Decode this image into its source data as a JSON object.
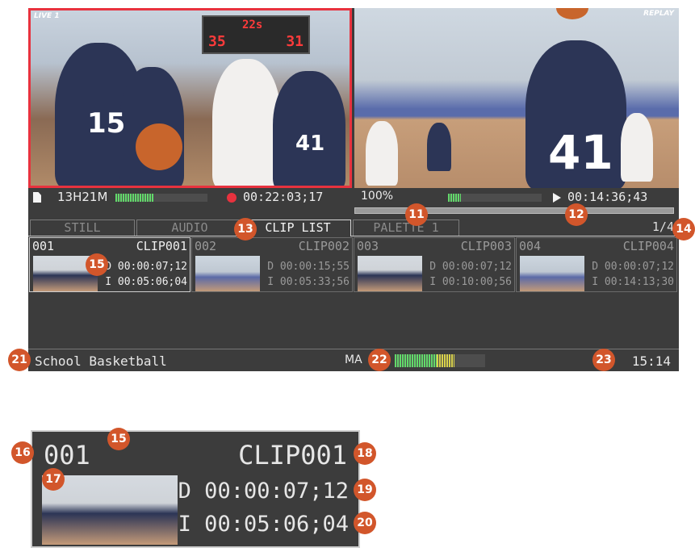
{
  "screen": {
    "live_label": "LIVE 1",
    "replay_label": "REPLAY",
    "scoreboard": {
      "clock": "22s",
      "home": "35",
      "away": "31"
    },
    "live_jerseys": [
      "15",
      "41"
    ],
    "replay_jerseys": [
      "41"
    ],
    "status_left": {
      "remaining": "13H21M",
      "rec_time": "00:22:03;17"
    },
    "status_right": {
      "zoom": "100%",
      "play_time": "00:14:36;43"
    },
    "tabs": [
      {
        "label": "STILL",
        "active": false
      },
      {
        "label": "AUDIO",
        "active": false
      },
      {
        "label": "CLIP LIST",
        "active": true
      },
      {
        "label": "PALETTE 1",
        "active": false
      }
    ],
    "pager": "1/4",
    "clips": [
      {
        "num": "001",
        "name": "CLIP001",
        "duration": "D 00:00:07;12",
        "in": "I 00:05:06;04",
        "selected": true
      },
      {
        "num": "002",
        "name": "CLIP002",
        "duration": "D 00:00:15;55",
        "in": "I 00:05:33;56",
        "selected": false
      },
      {
        "num": "003",
        "name": "CLIP003",
        "duration": "D 00:00:07;12",
        "in": "I 00:10:00;56",
        "selected": false
      },
      {
        "num": "004",
        "name": "CLIP004",
        "duration": "D 00:00:07;12",
        "in": "I 00:14:13;30",
        "selected": false
      }
    ],
    "bottom": {
      "project": "School Basketball",
      "audio_label": "MA",
      "clock": "15:14"
    }
  },
  "zoom": {
    "num": "001",
    "name": "CLIP001",
    "duration": "D 00:00:07;12",
    "in": "I 00:05:06;04"
  },
  "callouts": [
    "11",
    "12",
    "13",
    "14",
    "15",
    "15",
    "16",
    "17",
    "18",
    "19",
    "20",
    "21",
    "22",
    "23"
  ],
  "colors": {
    "callout": "#d2562b",
    "rec": "#e8323e",
    "meter_green": "#62d96a",
    "meter_yellow": "#d9d24a"
  }
}
